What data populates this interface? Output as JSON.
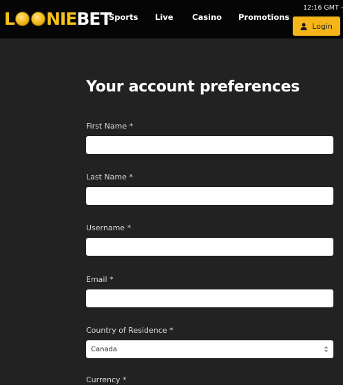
{
  "brand": {
    "logo_lead": "L",
    "logo_mid": "NIE",
    "logo_tail": "BET",
    "gold": "#f6c21b"
  },
  "nav": {
    "items": [
      {
        "label": "Sports"
      },
      {
        "label": "Live"
      },
      {
        "label": "Casino"
      },
      {
        "label": "Promotions"
      }
    ]
  },
  "clock": "12:16 GMT +",
  "login": {
    "label": "Login",
    "icon": "user-icon",
    "color": "#f6b619"
  },
  "page": {
    "title": "Your account preferences"
  },
  "form": {
    "first_name": {
      "label": "First Name *",
      "value": ""
    },
    "last_name": {
      "label": "Last Name *",
      "value": ""
    },
    "username": {
      "label": "Username *",
      "value": ""
    },
    "email": {
      "label": "Email *",
      "value": ""
    },
    "country": {
      "label": "Country of Residence *",
      "value": "Canada"
    },
    "currency": {
      "label": "Currency *"
    }
  }
}
